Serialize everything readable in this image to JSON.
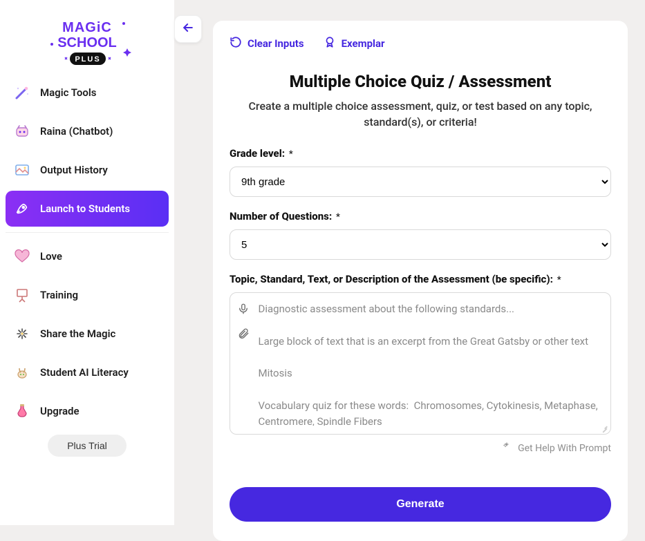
{
  "brand": {
    "name": "MAGIC SCHOOL",
    "tier": "PLUS"
  },
  "sidebar": {
    "items": [
      {
        "label": "Magic Tools"
      },
      {
        "label": "Raina (Chatbot)"
      },
      {
        "label": "Output History"
      },
      {
        "label": "Launch to Students"
      },
      {
        "label": "Love"
      },
      {
        "label": "Training"
      },
      {
        "label": "Share the Magic"
      },
      {
        "label": "Student AI Literacy"
      },
      {
        "label": "Upgrade"
      }
    ],
    "plus_trial": "Plus Trial"
  },
  "toolbar": {
    "clear": "Clear Inputs",
    "exemplar": "Exemplar"
  },
  "page": {
    "title": "Multiple Choice Quiz / Assessment",
    "subtitle": "Create a multiple choice assessment, quiz, or test based on any topic, standard(s), or criteria!"
  },
  "form": {
    "grade_label": "Grade level:",
    "grade_value": "9th grade",
    "num_label": "Number of Questions:",
    "num_value": "5",
    "topic_label": "Topic, Standard, Text, or Description of the Assessment (be specific):",
    "topic_placeholder": "Diagnostic assessment about the following standards...\n\nLarge block of text that is an excerpt from the Great Gatsby or other text\n\nMitosis\n\nVocabulary quiz for these words:  Chromosomes, Cytokinesis, Metaphase, Centromere, Spindle Fibers",
    "required_mark": "*",
    "help": "Get Help With Prompt",
    "generate": "Generate"
  },
  "colors": {
    "accent": "#4628e0",
    "gradient_a": "#8b2ff4",
    "gradient_b": "#5a2ff4"
  }
}
